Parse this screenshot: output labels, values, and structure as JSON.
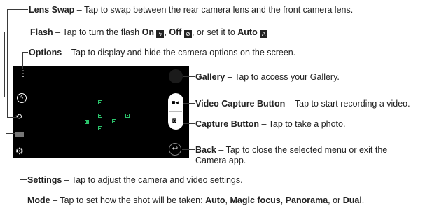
{
  "annotations": {
    "lens_swap": {
      "term": "Lens Swap",
      "text": " – Tap to swap between the rear camera lens and the front camera lens."
    },
    "flash": {
      "term": "Flash",
      "text_a": " – Tap to turn the flash ",
      "on": "On",
      "text_b": ", ",
      "off": "Off",
      "text_c": ", or set it to ",
      "auto": "Auto"
    },
    "options": {
      "term": "Options",
      "text": " – Tap to display and hide the camera options on the screen."
    },
    "gallery": {
      "term": "Gallery",
      "text": " – Tap to access your Gallery."
    },
    "video_capture": {
      "term": "Video Capture Button",
      "text": " – Tap to start recording a video."
    },
    "capture": {
      "term": "Capture Button",
      "text": " – Tap to take a photo."
    },
    "back": {
      "term": "Back",
      "text_line1": " – Tap to close the selected menu or exit the",
      "text_line2": "Camera app."
    },
    "settings": {
      "term": "Settings",
      "text": " – Tap to adjust the camera and video settings."
    },
    "mode": {
      "term": "Mode",
      "text_a": " – Tap to set how the shot will be taken: ",
      "opt1": "Auto",
      "sep1": ", ",
      "opt2": "Magic focus",
      "sep2": ", ",
      "opt3": "Panorama",
      "sep3": ", or ",
      "opt4": "Dual",
      "end": "."
    }
  },
  "icons": {
    "options": "vertical-dots-icon",
    "flash": "flash-icon",
    "lens_swap": "camera-swap-icon",
    "mode": "mode-icon",
    "settings": "gear-icon",
    "gallery": "gallery-thumbnail",
    "video": "video-camera-icon",
    "capture": "camera-icon",
    "back": "back-arrow-icon"
  },
  "colors": {
    "focus": "#2bc46b",
    "viewfinder": "#000000"
  }
}
